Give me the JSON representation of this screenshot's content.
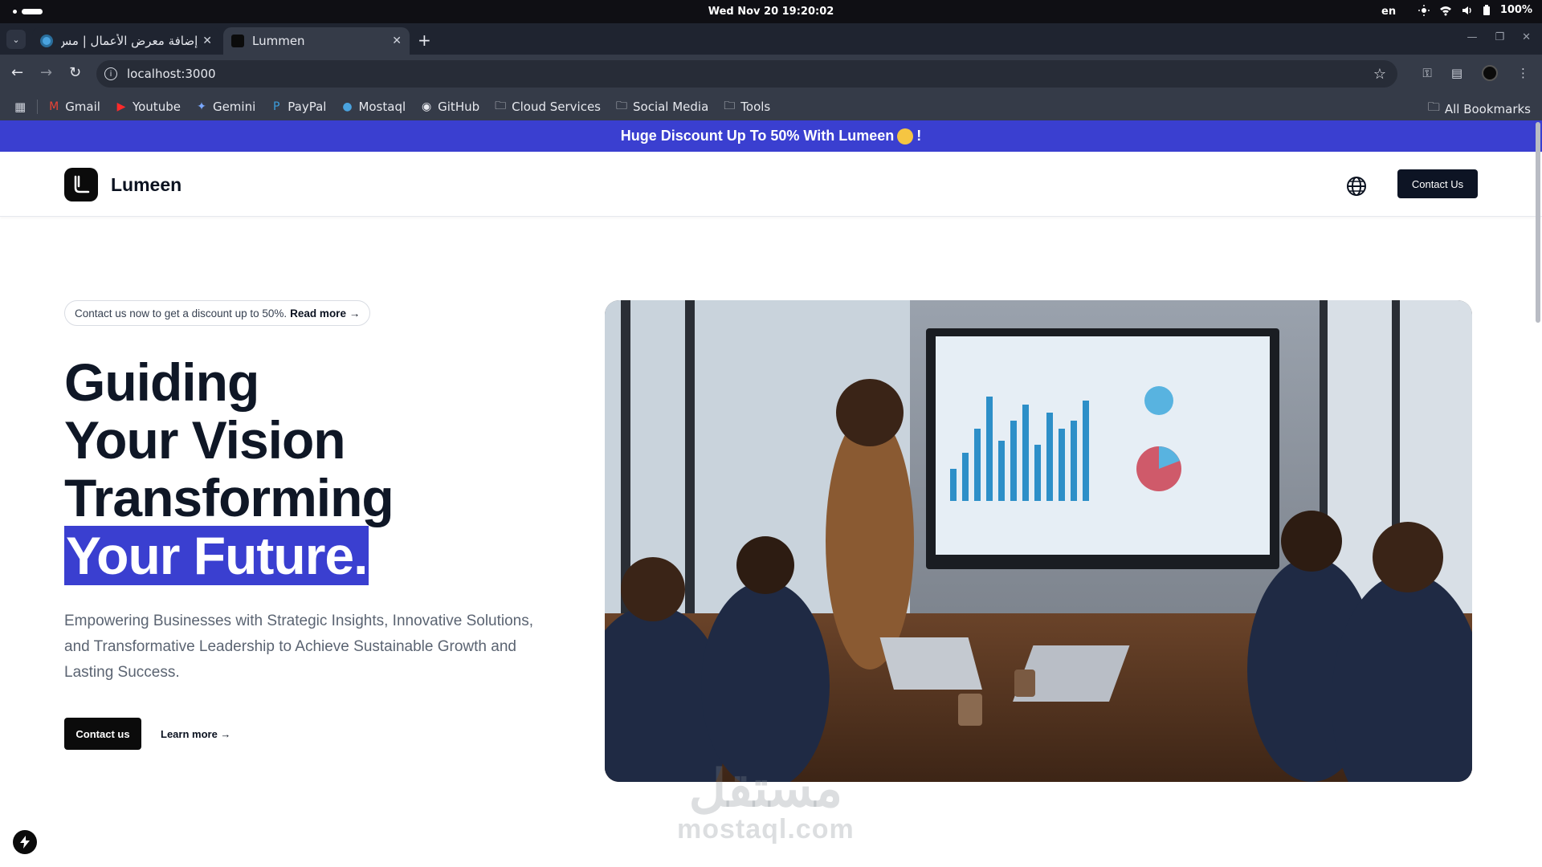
{
  "os": {
    "clock": "Wed Nov 20  19:20:02",
    "lang": "en",
    "battery": "100%"
  },
  "browser": {
    "tabs": [
      {
        "title": "إضافة معرض الأعمال | مس",
        "active": false,
        "favicon_color": "#4aa3df"
      },
      {
        "title": "Lummen",
        "active": true,
        "favicon_color": "#0b0b0b"
      }
    ],
    "url": "localhost:3000",
    "bookmarks": [
      {
        "label": "Gmail",
        "icon": "gmail-icon"
      },
      {
        "label": "Youtube",
        "icon": "youtube-icon"
      },
      {
        "label": "Gemini",
        "icon": "gemini-icon"
      },
      {
        "label": "PayPal",
        "icon": "paypal-icon"
      },
      {
        "label": "Mostaql",
        "icon": "mostaql-icon"
      },
      {
        "label": "GitHub",
        "icon": "github-icon"
      },
      {
        "label": "Cloud Services",
        "icon": "folder-icon"
      },
      {
        "label": "Social Media",
        "icon": "folder-icon"
      },
      {
        "label": "Tools",
        "icon": "folder-icon"
      }
    ],
    "all_bookmarks": "All Bookmarks"
  },
  "page": {
    "promo": {
      "text_before": "Huge Discount Up To 50% With Lumeen",
      "text_after": "!"
    },
    "brand": "Lumeen",
    "header_cta": "Contact Us",
    "note": {
      "text": "Contact us now to get a discount up to 50%.",
      "link": "Read more →"
    },
    "hero": {
      "line1": "Guiding",
      "line2": "Your Vision",
      "line3": "Transforming",
      "line4": "Your Future.",
      "description": "Empowering Businesses with Strategic Insights, Innovative Solutions, and Transformative Leadership to Achieve Sustainable Growth and Lasting Success.",
      "primary_cta": "Contact us",
      "secondary_cta": "Learn more →"
    },
    "watermark": {
      "arabic": "مستقل",
      "latin": "mostaql.com"
    },
    "colors": {
      "accent": "#3a3fd0",
      "dark": "#0d1424"
    }
  }
}
